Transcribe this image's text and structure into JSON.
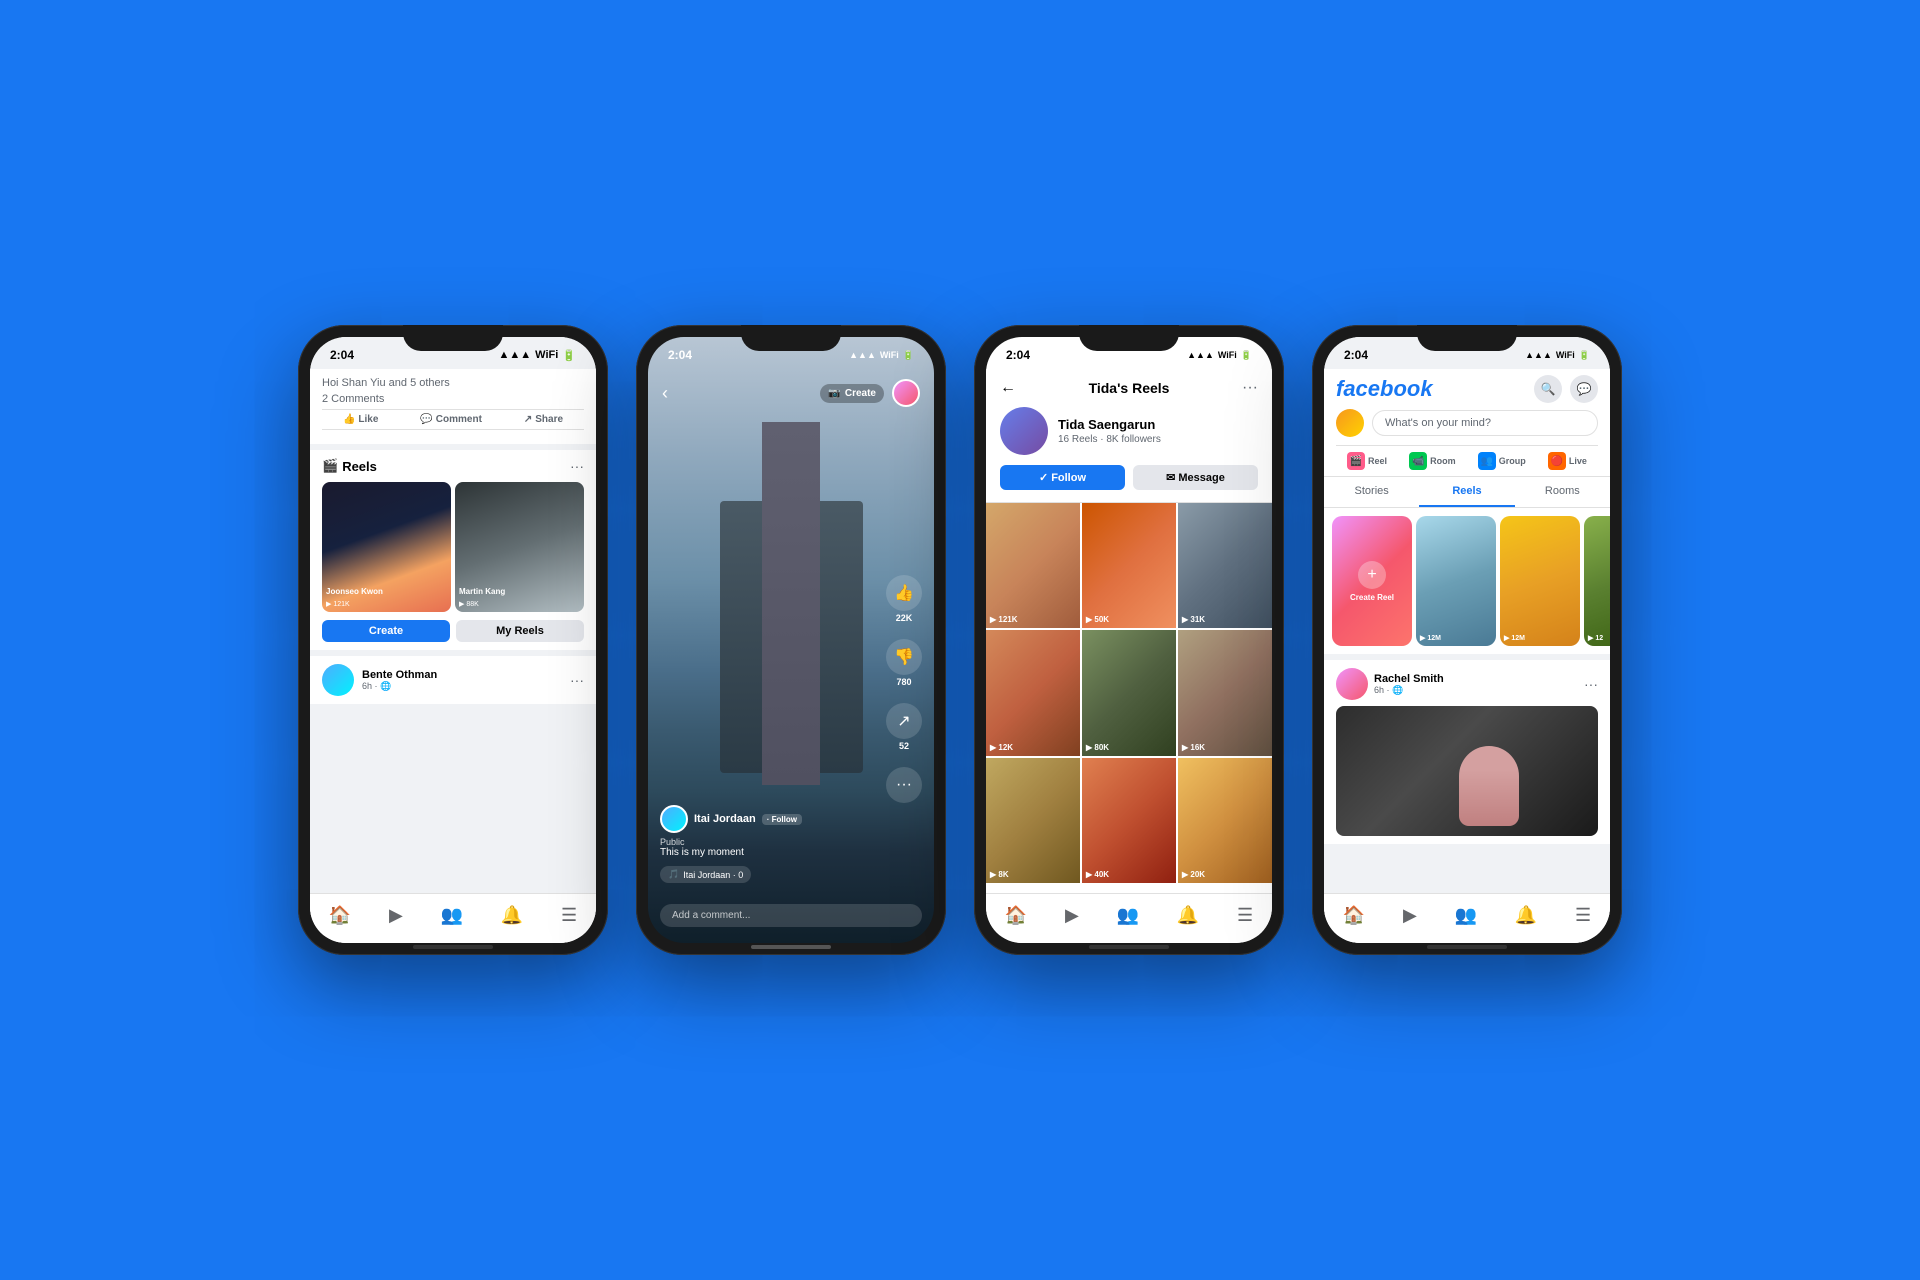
{
  "background_color": "#1877F2",
  "phones": [
    {
      "id": "phone1",
      "label": "Facebook Feed with Reels",
      "status_bar": {
        "time": "2:04",
        "theme": "dark"
      },
      "content": {
        "post": {
          "reactions": "Hoi Shan Yiu and 5 others",
          "comments": "2 Comments",
          "like_label": "Like",
          "comment_label": "Comment",
          "share_label": "Share"
        },
        "reels_section": {
          "title": "Reels",
          "reel1": {
            "name": "Joonseo Kwon",
            "views": "▶ 121K"
          },
          "reel2": {
            "name": "Martin Kang",
            "views": "▶ 88K"
          },
          "create_label": "Create",
          "my_reels_label": "My Reels"
        },
        "user_post": {
          "name": "Bente Othman",
          "time": "6h · 🌐"
        }
      }
    },
    {
      "id": "phone2",
      "label": "Video Reel Fullscreen",
      "status_bar": {
        "time": "2:04",
        "theme": "light"
      },
      "content": {
        "create_label": "Create",
        "user": "Itai Jordaan",
        "follow_label": "· Follow",
        "public_label": "Public",
        "caption": "This is my moment",
        "tag_label": "Itai Jordaan · 0",
        "comment_placeholder": "Add a comment...",
        "likes_count": "22K",
        "dislikes_count": "780",
        "shares_count": "52"
      }
    },
    {
      "id": "phone3",
      "label": "Tida's Reels Profile",
      "status_bar": {
        "time": "2:04",
        "theme": "dark"
      },
      "content": {
        "page_title": "Tida's Reels",
        "user_name": "Tida Saengarun",
        "user_meta": "16 Reels · 8K followers",
        "follow_label": "Follow",
        "message_label": "Message",
        "reels": [
          {
            "count": "▶ 121K",
            "color_class": "food1"
          },
          {
            "count": "▶ 50K",
            "color_class": "food2"
          },
          {
            "count": "▶ 31K",
            "color_class": "food3"
          },
          {
            "count": "▶ 12K",
            "color_class": "food4"
          },
          {
            "count": "▶ 80K",
            "color_class": "food5"
          },
          {
            "count": "▶ 16K",
            "color_class": "food6"
          },
          {
            "count": "▶ 8K",
            "color_class": "food7"
          },
          {
            "count": "▶ 40K",
            "color_class": "food8"
          },
          {
            "count": "▶ 20K",
            "color_class": "food9"
          }
        ]
      }
    },
    {
      "id": "phone4",
      "label": "Facebook Home",
      "status_bar": {
        "time": "2:04",
        "theme": "dark"
      },
      "content": {
        "logo": "facebook",
        "whats_on_mind": "What's on your mind?",
        "quick_actions": [
          {
            "label": "Reel",
            "icon": "🎬",
            "color": "qa-red"
          },
          {
            "label": "Room",
            "icon": "📹",
            "color": "qa-green"
          },
          {
            "label": "Group",
            "icon": "👥",
            "color": "qa-blue"
          },
          {
            "label": "Live",
            "icon": "🔴",
            "color": "qa-orange"
          }
        ],
        "tabs": [
          {
            "label": "Stories",
            "active": false
          },
          {
            "label": "Reels",
            "active": true
          },
          {
            "label": "Rooms",
            "active": false
          }
        ],
        "reels_row": [
          {
            "type": "create",
            "label": "Create Reel"
          },
          {
            "type": "reel",
            "color_class": "reel4-1",
            "count": "▶ 12M"
          },
          {
            "type": "reel",
            "color_class": "reel4-2",
            "count": "▶ 12M"
          },
          {
            "type": "reel",
            "color_class": "reel4-3",
            "count": "▶ 12"
          }
        ],
        "post_user": {
          "name": "Rachel Smith",
          "time": "6h · 🌐"
        }
      }
    }
  ]
}
